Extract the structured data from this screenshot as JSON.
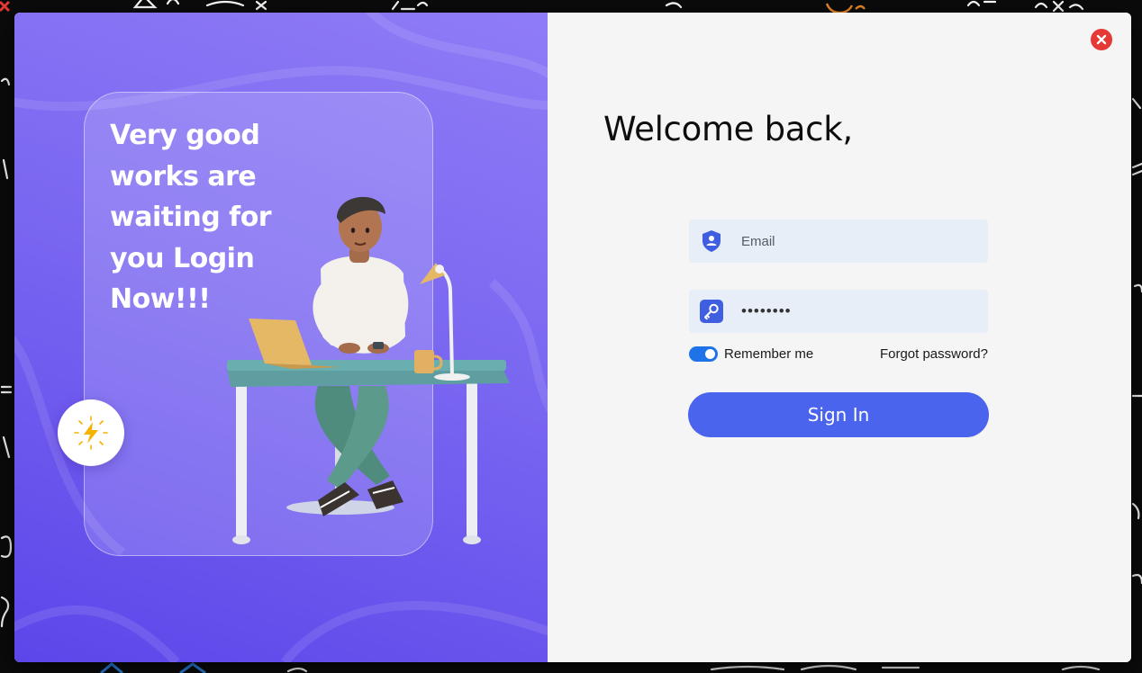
{
  "left_panel": {
    "headline": "Very good works are waiting for you Login Now!!!",
    "badge_icon": "lightning-bolt-icon",
    "gradient_colors": [
      "#8f7cf6",
      "#5c46ea"
    ]
  },
  "login_form": {
    "title": "Welcome back,",
    "close_icon": "close-icon",
    "email": {
      "icon": "user-shield-icon",
      "placeholder": "Email",
      "value": ""
    },
    "password": {
      "icon": "key-icon",
      "value": "••••••••"
    },
    "remember_me": {
      "label": "Remember me",
      "checked": true
    },
    "forgot_password": "Forgot password?",
    "sign_in_label": "Sign In",
    "accent_color": "#4a64ee",
    "close_color": "#e53935"
  }
}
